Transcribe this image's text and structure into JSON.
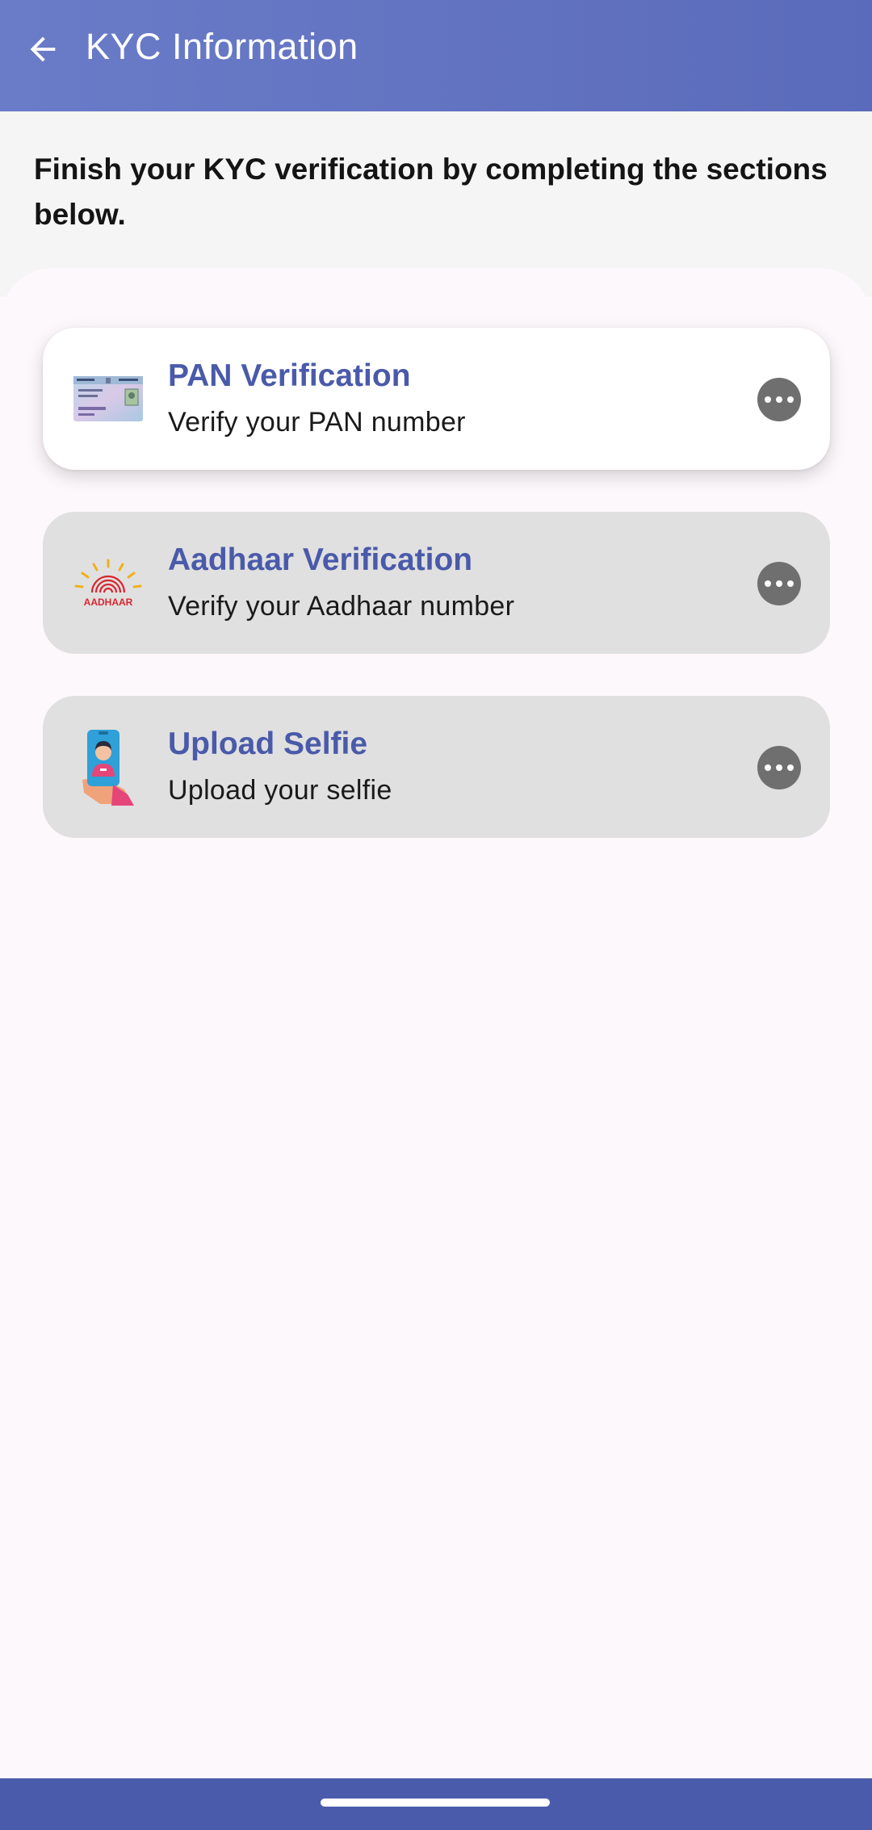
{
  "app_bar": {
    "title": "KYC Information",
    "back_icon": "arrow-left-icon"
  },
  "intro": {
    "text": "Finish your KYC verification by completing the sections below."
  },
  "cards": [
    {
      "title": "PAN Verification",
      "subtitle": "Verify your PAN number",
      "icon": "pan-card-icon",
      "state": "active"
    },
    {
      "title": "Aadhaar Verification",
      "subtitle": "Verify your Aadhaar number",
      "icon": "aadhaar-logo-icon",
      "logo_text": "AADHAAR",
      "state": "disabled"
    },
    {
      "title": "Upload Selfie",
      "subtitle": "Upload your selfie",
      "icon": "selfie-phone-icon",
      "state": "disabled"
    }
  ],
  "colors": {
    "app_bar": "#5b6bbb",
    "accent_title": "#4a5aaa",
    "nav_bar": "#4b5bab",
    "disabled_card": "#e0e0e0"
  }
}
